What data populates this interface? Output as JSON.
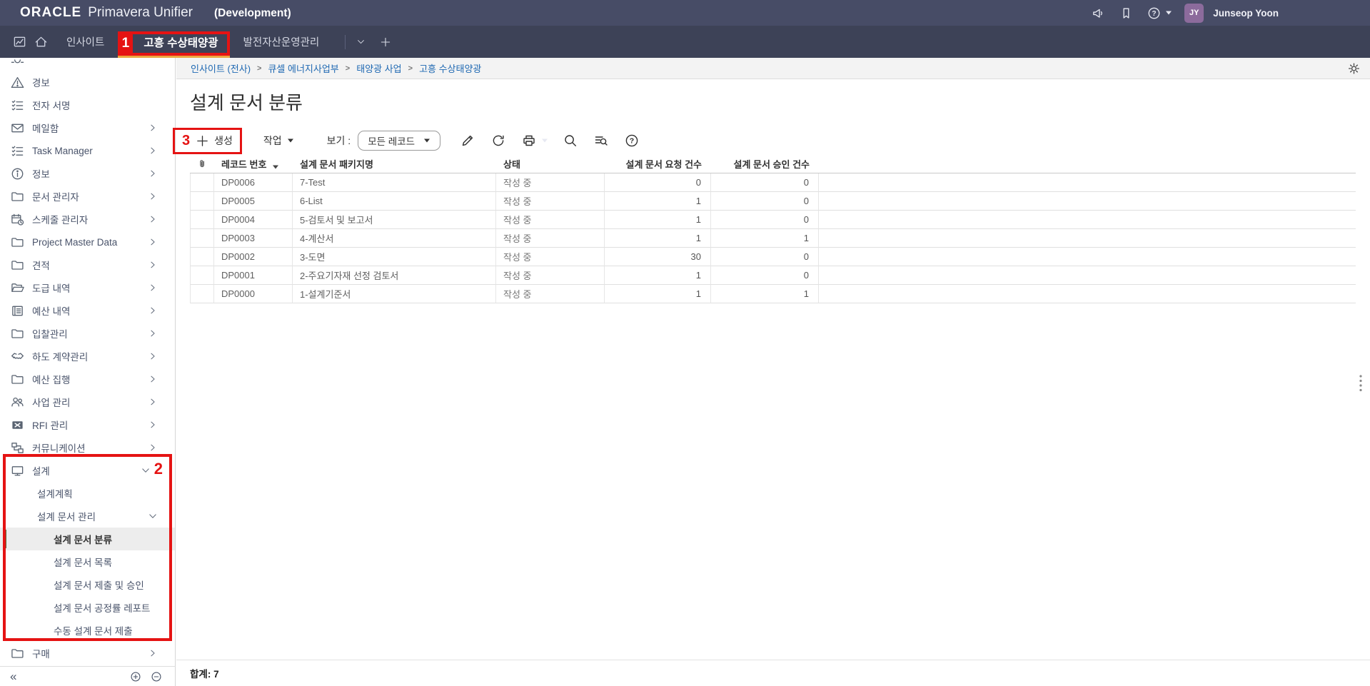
{
  "header": {
    "logo_oracle": "ORACLE",
    "logo_product": "Primavera Unifier",
    "environment": "(Development)",
    "icons": [
      "announcements",
      "bookmarks",
      "help"
    ],
    "user_initials": "JY",
    "user_name": "Junseop Yoon"
  },
  "tabbar": {
    "leading_icons": [
      "insights-chart",
      "home"
    ],
    "tabs": [
      {
        "label": "인사이트",
        "active": false
      },
      {
        "label": "고흥 수상태양광",
        "active": true
      },
      {
        "label": "발전자산운영관리",
        "active": false
      }
    ]
  },
  "breadcrumb": {
    "items": [
      "인사이트 (전사)",
      "큐셀 에너지사업부",
      "태양광 사업",
      "고흥 수상태양광"
    ],
    "separator": ">"
  },
  "page": {
    "title": "설계 문서 분류"
  },
  "toolbar": {
    "create_label": "생성",
    "actions_label": "작업",
    "view_label": "보기 :",
    "view_value": "모든 레코드",
    "icon_buttons": [
      "edit",
      "refresh",
      "print",
      "search",
      "find-in-list",
      "help"
    ]
  },
  "table": {
    "columns": [
      {
        "label": "",
        "type": "attachment",
        "align": "left"
      },
      {
        "label": "레코드 번호",
        "align": "left",
        "sorted": "desc"
      },
      {
        "label": "설계 문서 패키지명",
        "align": "left"
      },
      {
        "label": "상태",
        "align": "left"
      },
      {
        "label": "설계 문서 요청 건수",
        "align": "right"
      },
      {
        "label": "설계 문서 승인 건수",
        "align": "right"
      }
    ],
    "rows": [
      {
        "record_no": "DP0006",
        "package_name": "7-Test",
        "status": "작성 중",
        "requested": "0",
        "approved": "0"
      },
      {
        "record_no": "DP0005",
        "package_name": "6-List",
        "status": "작성 중",
        "requested": "1",
        "approved": "0"
      },
      {
        "record_no": "DP0004",
        "package_name": "5-검토서 및 보고서",
        "status": "작성 중",
        "requested": "1",
        "approved": "0"
      },
      {
        "record_no": "DP0003",
        "package_name": "4-계산서",
        "status": "작성 중",
        "requested": "1",
        "approved": "1"
      },
      {
        "record_no": "DP0002",
        "package_name": "3-도면",
        "status": "작성 중",
        "requested": "30",
        "approved": "0"
      },
      {
        "record_no": "DP0001",
        "package_name": "2-주요기자재 선정 검토서",
        "status": "작성 중",
        "requested": "1",
        "approved": "0"
      },
      {
        "record_no": "DP0000",
        "package_name": "1-설계기준서",
        "status": "작성 중",
        "requested": "1",
        "approved": "1"
      }
    ],
    "footer_total": "합계: 7"
  },
  "sidebar": {
    "items": [
      {
        "label": "경보",
        "icon": "alert-triangle",
        "level": 0,
        "chevron": "none",
        "selected": false
      },
      {
        "label": "전자 서명",
        "icon": "checklist",
        "level": 0,
        "chevron": "none",
        "selected": false
      },
      {
        "label": "메일함",
        "icon": "mail",
        "level": 0,
        "chevron": "right",
        "selected": false
      },
      {
        "label": "Task Manager",
        "icon": "checklist",
        "level": 0,
        "chevron": "right",
        "selected": false
      },
      {
        "label": "정보",
        "icon": "info-circle",
        "level": 0,
        "chevron": "right",
        "selected": false
      },
      {
        "label": "문서 관리자",
        "icon": "folder",
        "level": 0,
        "chevron": "right",
        "selected": false
      },
      {
        "label": "스케줄 관리자",
        "icon": "calendar-clock",
        "level": 0,
        "chevron": "right",
        "selected": false
      },
      {
        "label": "Project Master Data",
        "icon": "folder",
        "level": 0,
        "chevron": "right",
        "selected": false
      },
      {
        "label": "견적",
        "icon": "folder",
        "level": 0,
        "chevron": "right",
        "selected": false
      },
      {
        "label": "도급 내역",
        "icon": "folder-open",
        "level": 0,
        "chevron": "right",
        "selected": false
      },
      {
        "label": "예산 내역",
        "icon": "ledger",
        "level": 0,
        "chevron": "right",
        "selected": false
      },
      {
        "label": "입찰관리",
        "icon": "folder",
        "level": 0,
        "chevron": "right",
        "selected": false
      },
      {
        "label": "하도 계약관리",
        "icon": "handshake",
        "level": 0,
        "chevron": "right",
        "selected": false
      },
      {
        "label": "예산 집행",
        "icon": "folder",
        "level": 0,
        "chevron": "right",
        "selected": false
      },
      {
        "label": "사업 관리",
        "icon": "people",
        "level": 0,
        "chevron": "right",
        "selected": false
      },
      {
        "label": "RFI 관리",
        "icon": "rfi",
        "level": 0,
        "chevron": "right",
        "selected": false
      },
      {
        "label": "커뮤니케이션",
        "icon": "network",
        "level": 0,
        "chevron": "right",
        "selected": false
      },
      {
        "label": "설계",
        "icon": "monitor",
        "level": 0,
        "chevron": "down",
        "selected": false
      },
      {
        "label": "설계계획",
        "icon": "",
        "level": 1,
        "chevron": "none",
        "selected": false
      },
      {
        "label": "설계 문서 관리",
        "icon": "",
        "level": 1,
        "chevron": "down",
        "selected": false
      },
      {
        "label": "설계 문서 분류",
        "icon": "",
        "level": 2,
        "chevron": "none",
        "selected": true
      },
      {
        "label": "설계 문서 목록",
        "icon": "",
        "level": 2,
        "chevron": "none",
        "selected": false
      },
      {
        "label": "설계 문서 제출 및 승인",
        "icon": "",
        "level": 2,
        "chevron": "none",
        "selected": false
      },
      {
        "label": "설계 문서 공정률 레포트",
        "icon": "",
        "level": 2,
        "chevron": "none",
        "selected": false
      },
      {
        "label": "수동 설계 문서 제출",
        "icon": "",
        "level": 2,
        "chevron": "none",
        "selected": false
      },
      {
        "label": "구매",
        "icon": "folder",
        "level": 0,
        "chevron": "right",
        "selected": false
      }
    ],
    "collapse_label": "«"
  },
  "annotations": {
    "n1": "1",
    "n2": "2",
    "n3": "3",
    "color": "#e51313"
  }
}
